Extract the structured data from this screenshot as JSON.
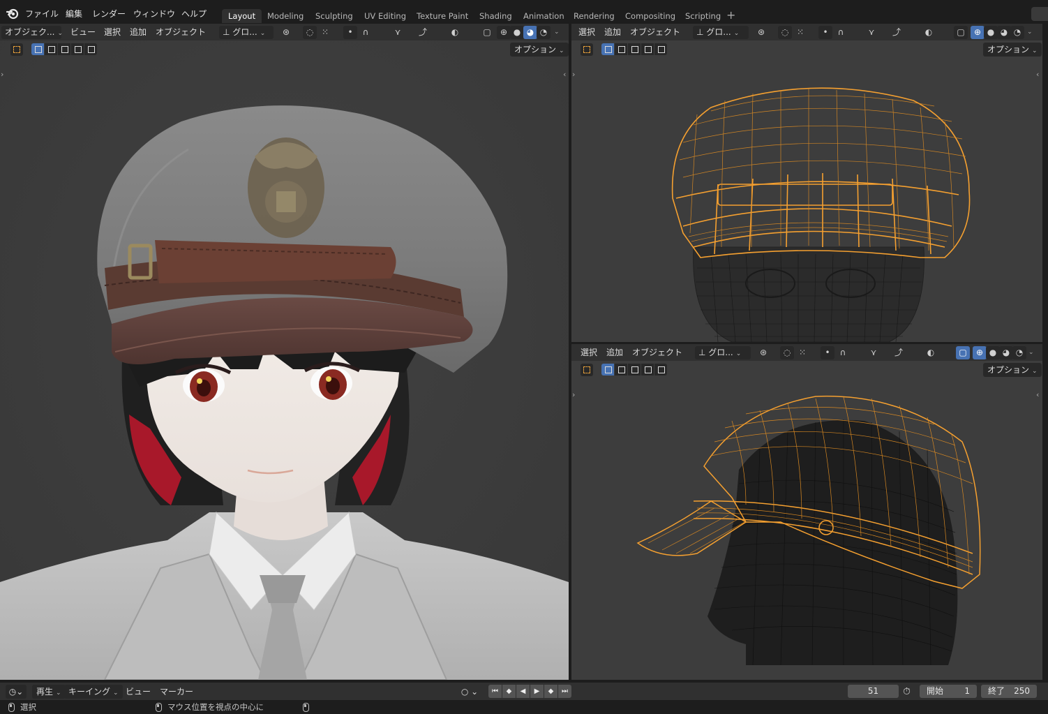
{
  "app": {
    "menus": [
      "ファイル",
      "編集",
      "レンダー",
      "ウィンドウ",
      "ヘルプ"
    ],
    "workspace_tabs": [
      "Layout",
      "Modeling",
      "Sculpting",
      "UV Editing",
      "Texture Paint",
      "Shading",
      "Animation",
      "Rendering",
      "Compositing",
      "Scripting"
    ],
    "active_tab": "Layout",
    "add_tab": "+"
  },
  "viewport_main": {
    "mode": "オブジェク...",
    "menu": [
      "ビュー",
      "選択",
      "追加",
      "オブジェクト"
    ],
    "transform": "グロ...",
    "options": "オプション"
  },
  "viewport_top_right": {
    "menu": [
      "選択",
      "追加",
      "オブジェクト"
    ],
    "transform": "グロ...",
    "options": "オプション"
  },
  "viewport_bottom_right": {
    "menu": [
      "選択",
      "追加",
      "オブジェクト"
    ],
    "transform": "グロ...",
    "options": "オプション"
  },
  "timeline": {
    "playback": "再生",
    "keying": "キーイング",
    "view": "ビュー",
    "marker": "マーカー",
    "current_frame": "51",
    "start_label": "開始",
    "start_value": "1",
    "end_label": "終了",
    "end_value": "250"
  },
  "statusbar": {
    "left_action": "選択",
    "middle_action": "マウス位置を視点の中心に"
  },
  "colors": {
    "selection_orange": "#f5a030",
    "accent_blue": "#4772b3",
    "viewport_bg": "#3d3d3d",
    "header_bg": "#303030"
  }
}
